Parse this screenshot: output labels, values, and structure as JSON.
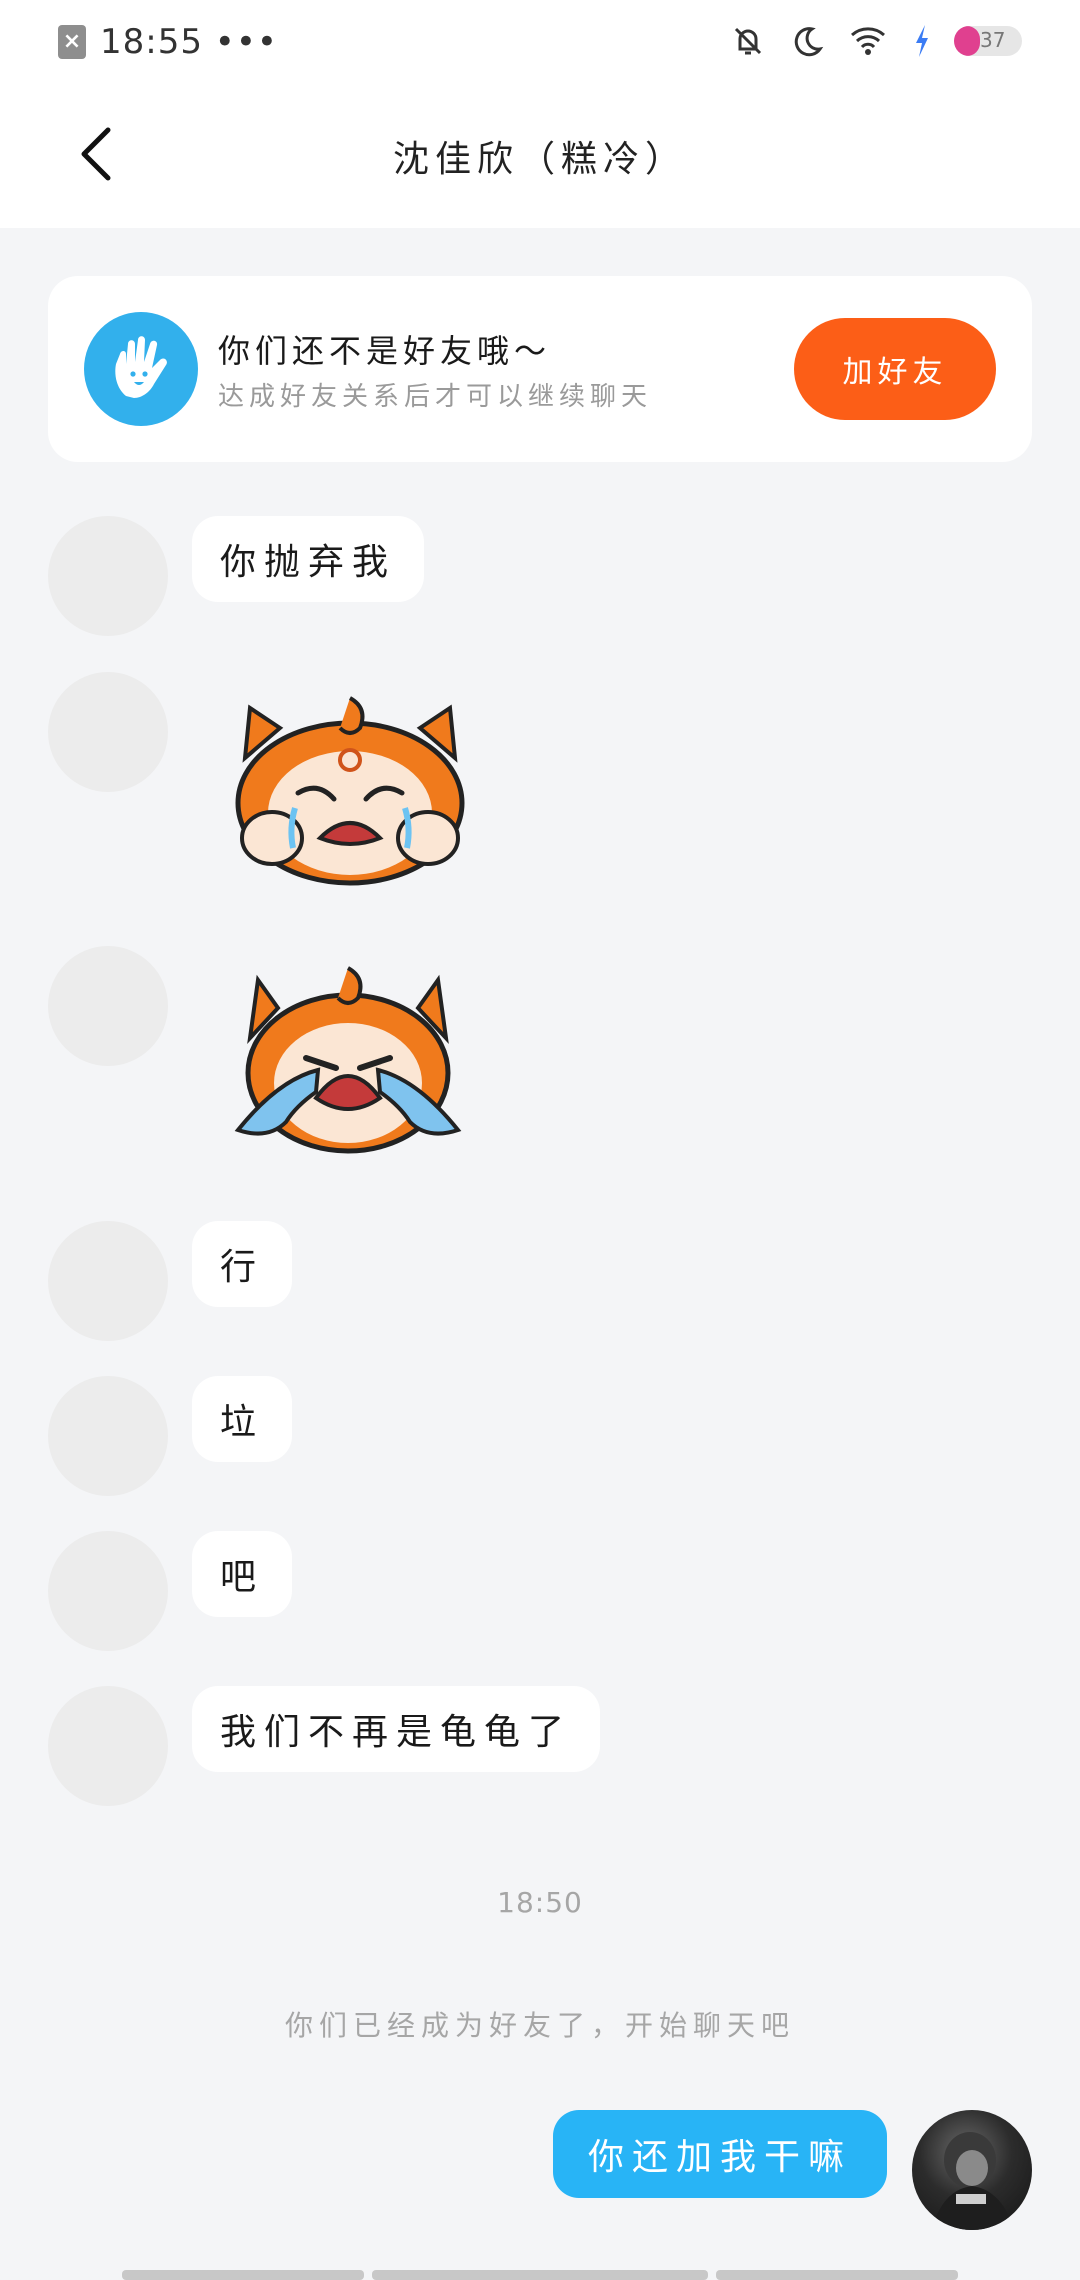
{
  "status_bar": {
    "time": "18:55",
    "dots": "•••",
    "battery": "37",
    "icons": [
      "close-icon",
      "bell-off-icon",
      "moon-icon",
      "wifi-icon",
      "charging-icon",
      "battery-icon"
    ]
  },
  "header": {
    "title": "沈佳欣（糕冷）"
  },
  "friend_banner": {
    "title": "你们还不是好友哦～",
    "subtitle": "达成好友关系后才可以继续聊天",
    "button": "加好友",
    "button_color": "#fc5e17",
    "avatar_color": "#32b0ec"
  },
  "messages": [
    {
      "type": "text",
      "text": "你抛弃我"
    },
    {
      "type": "sticker",
      "sticker": "crying-cat-sticker"
    },
    {
      "type": "sticker",
      "sticker": "sobbing-cat-sticker"
    },
    {
      "type": "text",
      "text": "行"
    },
    {
      "type": "text",
      "text": "垃"
    },
    {
      "type": "text",
      "text": "吧"
    },
    {
      "type": "text",
      "text": "我们不再是龟龟了"
    }
  ],
  "time_divider": "18:50",
  "system_tip": "你们已经成为好友了，开始聊天吧",
  "my_message": {
    "text": "你还加我干嘛",
    "color": "#28b4f6"
  }
}
